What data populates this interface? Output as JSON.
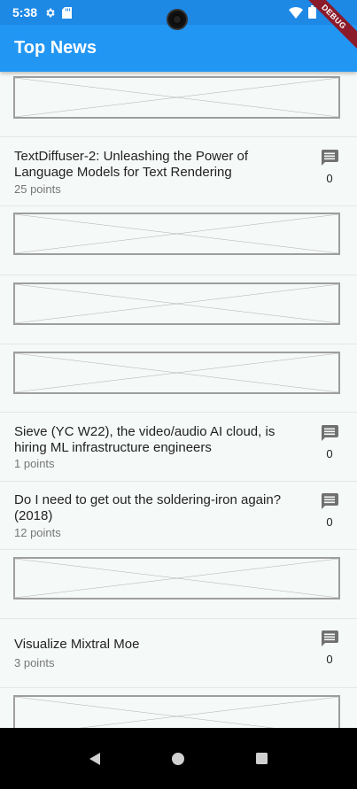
{
  "status": {
    "time": "5:38",
    "debug_label": "DEBUG"
  },
  "app_bar": {
    "title": "Top News"
  },
  "stories": [
    {
      "title": "TextDiffuser-2: Unleashing the Power of Language Models for Text Rendering",
      "points": "25 points",
      "comments": "0"
    },
    {
      "title": "Sieve (YC W22), the video/audio AI cloud, is hiring ML infrastructure engineers",
      "points": "1 points",
      "comments": "0"
    },
    {
      "title": "Do I need to get out the soldering-iron again? (2018)",
      "points": "12 points",
      "comments": "0"
    },
    {
      "title": "Visualize Mixtral Moe",
      "points": "3 points",
      "comments": "0"
    }
  ],
  "icons": {
    "settings": "gear-icon",
    "sd_card": "sd-card-icon",
    "wifi": "wifi-icon",
    "battery": "battery-icon",
    "comment": "comment-icon",
    "back": "back-triangle-icon",
    "home": "home-circle-icon",
    "recents": "recents-square-icon",
    "placeholder": "image-placeholder-icon"
  },
  "colors": {
    "app_bar": "#2196f3",
    "status_bar": "#1e88e5",
    "list_bg": "#f5f9f7",
    "debug_banner": "#8b1b2b"
  }
}
